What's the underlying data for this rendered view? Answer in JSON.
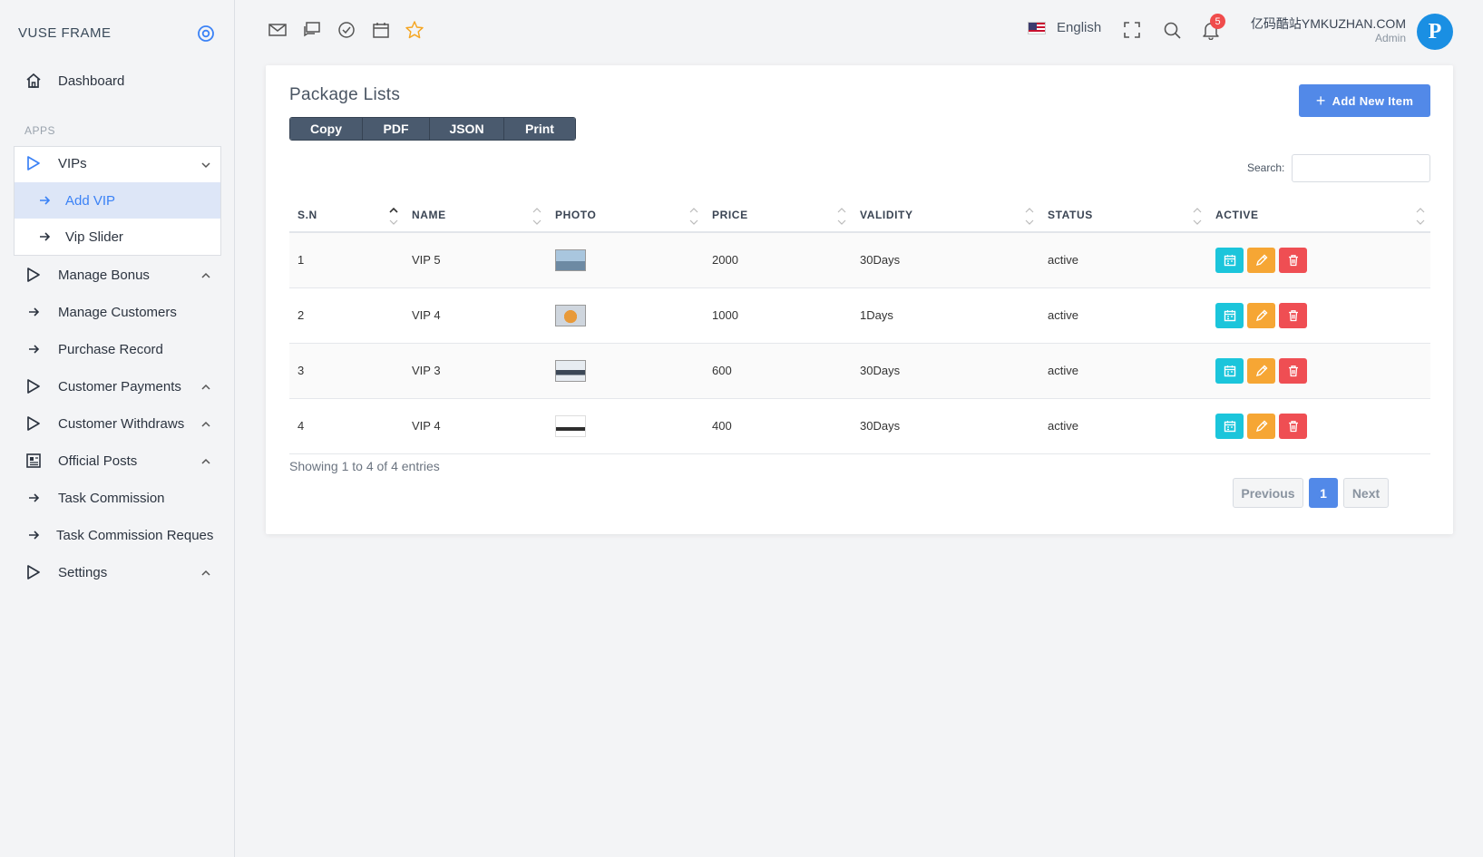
{
  "brand": "VUSE FRAME",
  "sidebar": {
    "dashboard": "Dashboard",
    "section_label": "APPS",
    "vips": "VIPs",
    "add_vip": "Add VIP",
    "vip_slider": "Vip Slider",
    "manage_bonus": "Manage Bonus",
    "manage_customers": "Manage Customers",
    "purchase_record": "Purchase Record",
    "customer_payments": "Customer Payments",
    "customer_withdraws": "Customer Withdraws",
    "official_posts": "Official Posts",
    "task_commission": "Task Commission",
    "task_commission_requests": "Task Commission Reques",
    "settings": "Settings"
  },
  "topbar": {
    "language": "English",
    "notification_count": "5",
    "user_name": "亿码酷站YMKUZHAN.COM",
    "user_role": "Admin"
  },
  "card": {
    "title": "Package Lists",
    "add_button": "Add New Item",
    "export_buttons": [
      "Copy",
      "PDF",
      "JSON",
      "Print"
    ],
    "search_label": "Search:"
  },
  "table": {
    "headers": [
      "S.N",
      "NAME",
      "PHOTO",
      "PRICE",
      "VALIDITY",
      "STATUS",
      "ACTIVE"
    ],
    "rows": [
      {
        "sn": "1",
        "name": "VIP 5",
        "price": "2000",
        "validity": "30Days",
        "status": "active"
      },
      {
        "sn": "2",
        "name": "VIP 4",
        "price": "1000",
        "validity": "1Days",
        "status": "active"
      },
      {
        "sn": "3",
        "name": "VIP 3",
        "price": "600",
        "validity": "30Days",
        "status": "active"
      },
      {
        "sn": "4",
        "name": "VIP 4",
        "price": "400",
        "validity": "30Days",
        "status": "active"
      }
    ]
  },
  "footer": {
    "info": "Showing 1 to 4 of 4 entries",
    "previous": "Previous",
    "current_page": "1",
    "next": "Next"
  },
  "colors": {
    "primary": "#5289e8",
    "view": "#1bc5db",
    "edit": "#f6a634",
    "delete": "#ef4e53"
  }
}
